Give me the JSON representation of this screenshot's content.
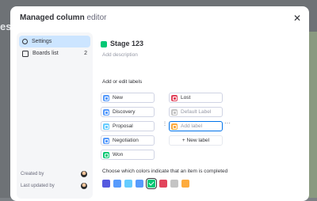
{
  "background": {
    "left_text": "es"
  },
  "modal": {
    "title_bold": "Managed column",
    "title_light": " editor"
  },
  "sidebar": {
    "items": [
      {
        "label": "Settings",
        "icon": "gear-icon"
      },
      {
        "label": "Boards list",
        "count": "2",
        "icon": "board-icon"
      }
    ],
    "created_by": "Created by",
    "last_updated_by": "Last updated by"
  },
  "main": {
    "stage_title": "Stage 123",
    "description_placeholder": "Add description",
    "labels_heading": "Add or edit labels",
    "labels_left": [
      {
        "label": "New",
        "color": "#579bfc"
      },
      {
        "label": "Discovery",
        "color": "#579bfc"
      },
      {
        "label": "Proposal",
        "color": "#66ccff"
      },
      {
        "label": "Negotiation",
        "color": "#579bfc"
      },
      {
        "label": "Won",
        "color": "#00c875"
      }
    ],
    "labels_right": [
      {
        "label": "Lost",
        "color": "#e2445c"
      },
      {
        "label": "Default Label",
        "color": "#c4c4c4"
      },
      {
        "label": "Add label",
        "color": "#fdab3d"
      }
    ],
    "new_label": "+ New label",
    "completed_heading": "Choose which colors indicate that an item is completed",
    "completed_colors": [
      {
        "color": "#5559df",
        "selected": false
      },
      {
        "color": "#579bfc",
        "selected": false
      },
      {
        "color": "#66ccff",
        "selected": false
      },
      {
        "color": "#579bfc",
        "selected": false
      },
      {
        "color": "#00c875",
        "selected": true
      },
      {
        "color": "#e2445c",
        "selected": false
      },
      {
        "color": "#c4c4c4",
        "selected": false
      },
      {
        "color": "#fdab3d",
        "selected": false
      }
    ]
  }
}
